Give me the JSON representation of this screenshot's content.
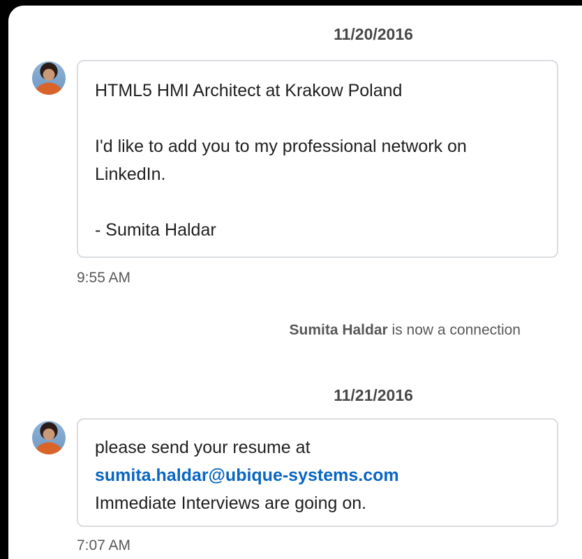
{
  "thread": [
    {
      "date": "11/20/2016",
      "message": {
        "headline": "HTML5 HMI Architect at Krakow Poland",
        "body": "I'd like to add you to my professional network on LinkedIn.",
        "signature": "- Sumita Haldar",
        "time": "9:55 AM"
      },
      "event": {
        "name": "Sumita Haldar",
        "text": " is now a connection"
      }
    },
    {
      "date": "11/21/2016",
      "message": {
        "line1": "please send your resume at",
        "email": "sumita.haldar@ubique-systems.com",
        "line3": "Immediate Interviews are going on.",
        "time": "7:07 AM"
      }
    }
  ],
  "avatar_icon": "user-avatar-photo"
}
